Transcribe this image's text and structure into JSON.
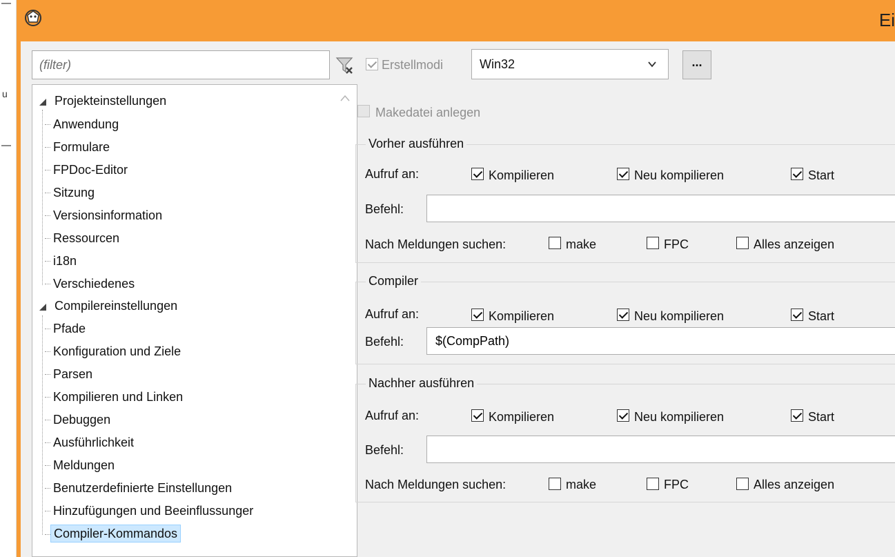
{
  "window": {
    "title": "Ei"
  },
  "filter": {
    "placeholder": "(filter)"
  },
  "tree": {
    "groups": [
      {
        "label": "Projekteinstellungen",
        "items": [
          "Anwendung",
          "Formulare",
          "FPDoc-Editor",
          "Sitzung",
          "Versionsinformation",
          "Ressourcen",
          "i18n",
          "Verschiedenes"
        ]
      },
      {
        "label": "Compilereinstellungen",
        "items": [
          "Pfade",
          "Konfiguration und Ziele",
          "Parsen",
          "Kompilieren und Linken",
          "Debuggen",
          "Ausführlichkeit",
          "Meldungen",
          "Benutzerdefinierte Einstellungen",
          "Hinzufügungen und Beeinflussunger",
          "Compiler-Kommandos"
        ]
      }
    ],
    "selected": "Compiler-Kommandos"
  },
  "buildmodes": {
    "label": "Erstellmodi",
    "checked": true,
    "value": "Win32",
    "button_label": "..."
  },
  "makefile": {
    "label": "Makedatei anlegen",
    "checked": false
  },
  "sections": {
    "before": {
      "title": "Vorher ausführen",
      "call_on_label": "Aufruf an:",
      "compile": "Kompilieren",
      "rebuild": "Neu kompilieren",
      "run": "Start",
      "command_label": "Befehl:",
      "command_value": "",
      "scan_label": "Nach Meldungen suchen:",
      "make": "make",
      "fpc": "FPC",
      "show_all": "Alles anzeigen"
    },
    "compiler": {
      "title": "Compiler",
      "call_on_label": "Aufruf an:",
      "compile": "Kompilieren",
      "rebuild": "Neu kompilieren",
      "run": "Start",
      "command_label": "Befehl:",
      "command_value": "$(CompPath)"
    },
    "after": {
      "title": "Nachher ausführen",
      "call_on_label": "Aufruf an:",
      "compile": "Kompilieren",
      "rebuild": "Neu kompilieren",
      "run": "Start",
      "command_label": "Befehl:",
      "command_value": "",
      "scan_label": "Nach Meldungen suchen:",
      "make": "make",
      "fpc": "FPC",
      "show_all": "Alles anzeigen"
    }
  },
  "background_window": {
    "fragment": "u"
  },
  "colors": {
    "titlebar": "#f79b35",
    "selection": "#cce8ff"
  }
}
